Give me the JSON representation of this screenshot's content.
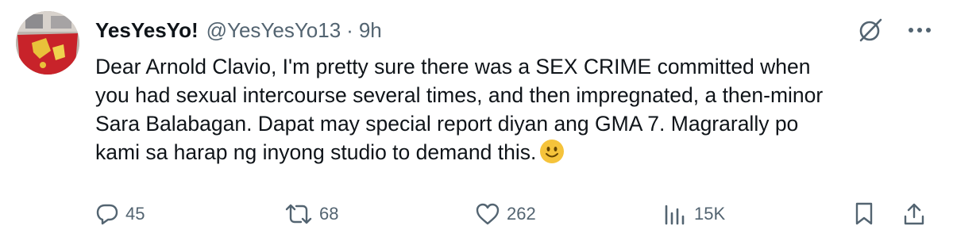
{
  "tweet": {
    "display_name": "YesYesYo!",
    "handle": "@YesYesYo13",
    "separator": "·",
    "time": "9h",
    "lines": [
      "Dear Arnold Clavio, I'm pretty sure there was a SEX CRIME committed when",
      "you had sexual intercourse several times, and then impregnated, a then-minor",
      "Sara Balabagan. Dapat may special report diyan ang GMA 7. Magrarally po",
      "kami sa harap ng inyong studio to demand this."
    ],
    "emoji": "slightly-smiling-face"
  },
  "actions": {
    "replies": "45",
    "reposts": "68",
    "likes": "262",
    "views": "15K"
  },
  "icons": {
    "top": [
      "grok-icon",
      "more-icon"
    ],
    "bottom": [
      "reply-icon",
      "repost-icon",
      "like-icon",
      "views-icon",
      "bookmark-icon",
      "share-icon"
    ]
  },
  "colors": {
    "text": "#0f1419",
    "secondary": "#536471",
    "emoji": "#f5c33b"
  }
}
